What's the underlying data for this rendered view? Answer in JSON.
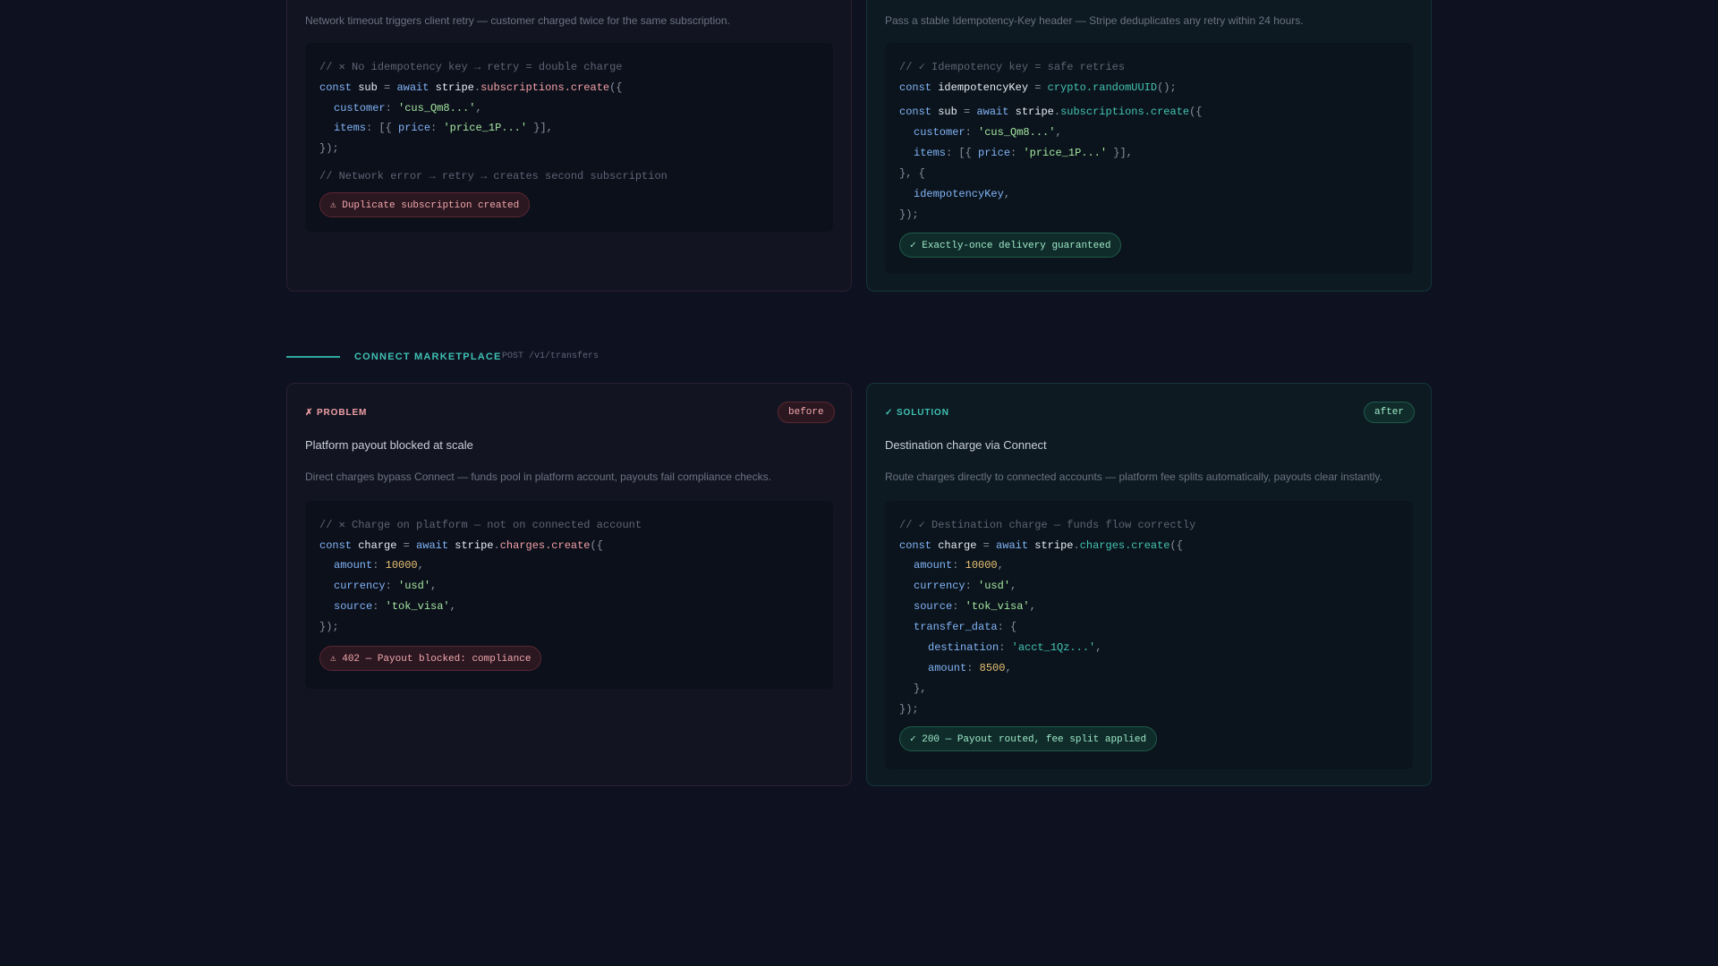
{
  "top_problem": {
    "description": "Network timeout triggers client retry — customer charged twice for the same subscription.",
    "code": {
      "comment": "// ✕ No idempotency key → retry = double charge",
      "const_kw": "const",
      "var": "sub",
      "eq": " = ",
      "await": "await",
      "obj": "stripe",
      "call": "subscriptions.create",
      "open": "({",
      "customer_key": "customer",
      "customer_val": "'cus_Qm8...'",
      "items_key": "items",
      "items_open": "[{ ",
      "price_key": "price",
      "price_val": "'price_1P...'",
      "items_close": " }],",
      "close": "});",
      "comment2": "// Network error → retry → creates second subscription"
    },
    "status": "⚠ Duplicate subscription created"
  },
  "top_solution": {
    "description": "Pass a stable Idempotency-Key header — Stripe deduplicates any retry within 24 hours.",
    "code": {
      "comment": "// ✓ Idempotency key = safe retries",
      "const_kw": "const",
      "key_var": "idempotencyKey",
      "eq": " = ",
      "crypto_call": "crypto.randomUUID",
      "crypto_end": "();",
      "var": "sub",
      "await": "await",
      "obj": "stripe",
      "call": "subscriptions.create",
      "open": "({",
      "customer_key": "customer",
      "customer_val": "'cus_Qm8...'",
      "items_key": "items",
      "items_open": "[{ ",
      "price_key": "price",
      "price_val": "'price_1P...'",
      "items_close": " }],",
      "mid": "}, {",
      "key_line": "idempotencyKey",
      "close": "});"
    },
    "status": "✓ Exactly-once delivery guaranteed"
  },
  "section": {
    "title": "CONNECT MARKETPLACE",
    "endpoint": "POST /v1/transfers"
  },
  "problem": {
    "label": "✗ PROBLEM",
    "badge": "before",
    "title": "Platform payout blocked at scale",
    "description": "Direct charges bypass Connect — funds pool in platform account, payouts fail compliance checks.",
    "code": {
      "comment": "// ✕ Charge on platform — not on connected account",
      "const_kw": "const",
      "var": "charge",
      "eq": " = ",
      "await": "await",
      "obj": "stripe",
      "call": "charges.create",
      "open": "({",
      "amount_key": "amount",
      "amount_val": "10000",
      "currency_key": "currency",
      "currency_val": "'usd'",
      "source_key": "source",
      "source_val": "'tok_visa'",
      "close": "});"
    },
    "status": "⚠ 402 — Payout blocked: compliance"
  },
  "solution": {
    "label": "✓ SOLUTION",
    "badge": "after",
    "title": "Destination charge via Connect",
    "description": "Route charges directly to connected accounts — platform fee splits automatically, payouts clear instantly.",
    "code": {
      "comment": "// ✓ Destination charge — funds flow correctly",
      "const_kw": "const",
      "var": "charge",
      "eq": " = ",
      "await": "await",
      "obj": "stripe",
      "call": "charges.create",
      "open": "({",
      "amount_key": "amount",
      "amount_val": "10000",
      "currency_key": "currency",
      "currency_val": "'usd'",
      "source_key": "source",
      "source_val": "'tok_visa'",
      "transfer_key": "transfer_data",
      "dest_key": "destination",
      "dest_val": "'acct_1Qz...'",
      "amount2_key": "amount",
      "amount2_val": "8500",
      "inner_close": "},",
      "close": "});"
    },
    "status": "✓ 200 — Payout routed, fee split applied"
  }
}
